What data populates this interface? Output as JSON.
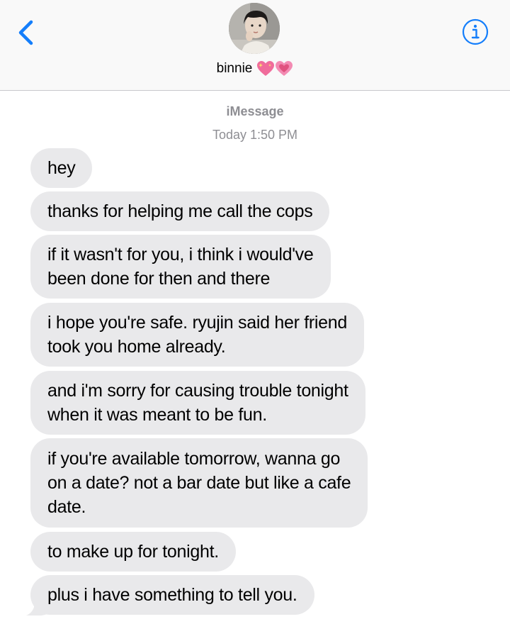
{
  "header": {
    "contact_name": "binnie",
    "avatar": "profile-photo",
    "back_icon": "chevron-left-icon",
    "info_icon": "info-circle-icon",
    "accent_color": "#147efb",
    "name_emoji": [
      "sparkling-heart-emoji",
      "growing-heart-emoji"
    ]
  },
  "conversation": {
    "service": "iMessage",
    "timestamp_day": "Today",
    "timestamp_time": "1:50 PM",
    "bubble_color": "#e9e9eb",
    "messages": [
      {
        "text": "hey"
      },
      {
        "text": "thanks for helping me call the cops"
      },
      {
        "text": "if it wasn't for you, i think i would've\nbeen done for then and there"
      },
      {
        "text": "i hope you're safe. ryujin said her friend\ntook you home already."
      },
      {
        "text": "and i'm sorry for causing trouble tonight\nwhen it was meant to be fun."
      },
      {
        "text": "if you're available tomorrow, wanna go\non a date? not a bar date but like a cafe\ndate."
      },
      {
        "text": "to make up for tonight."
      },
      {
        "text": "plus i have something to tell you."
      }
    ]
  }
}
